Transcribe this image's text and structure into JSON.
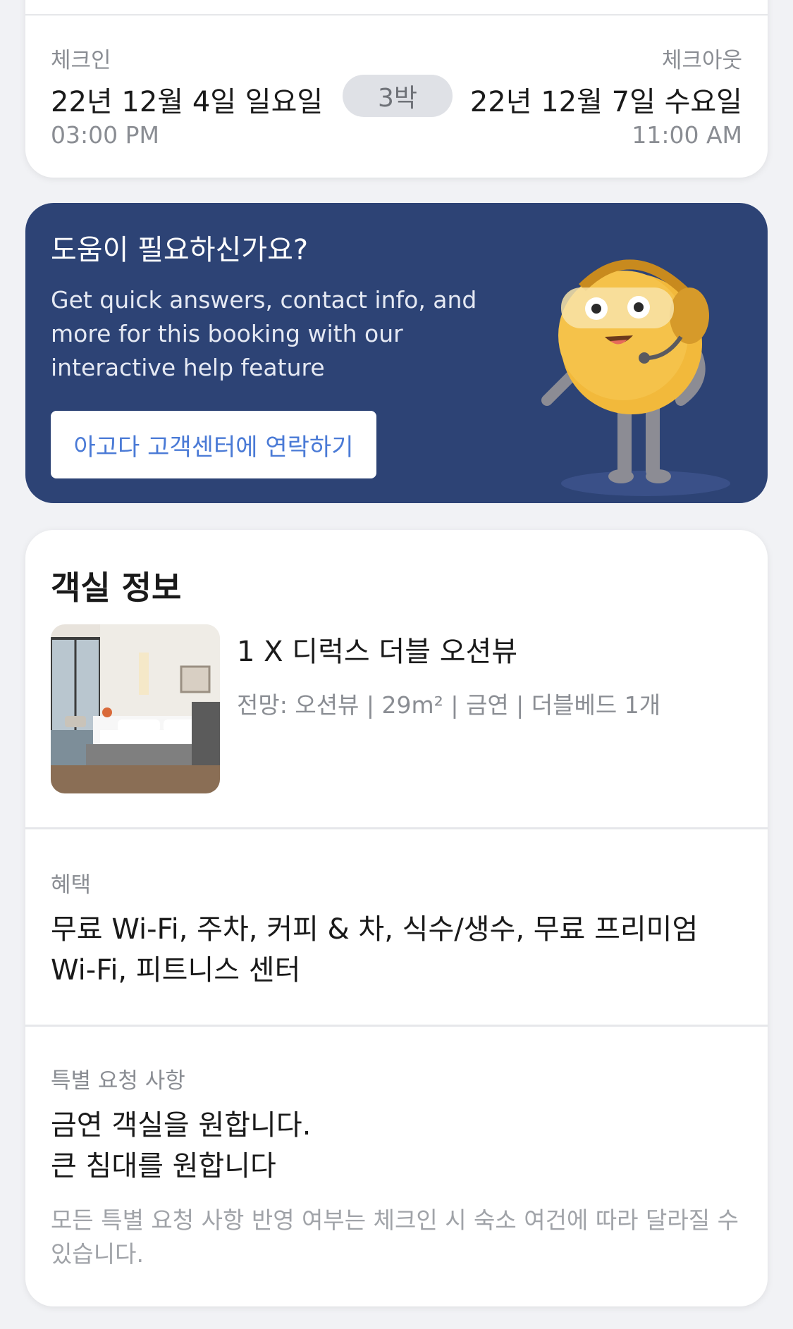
{
  "stay": {
    "checkin_label": "체크인",
    "checkin_date": "22년 12월 4일 일요일",
    "checkin_time": "03:00 PM",
    "nights": "3박",
    "checkout_label": "체크아웃",
    "checkout_date": "22년 12월 7일 수요일",
    "checkout_time": "11:00 AM"
  },
  "help": {
    "title": "도움이 필요하신가요?",
    "description": "Get quick answers, contact info, and more for this booking with our interactive help feature",
    "button_label": "아고다 고객센터에 연락하기",
    "background_color": "#2d4375",
    "mascot_icon": "headset-mascot-icon"
  },
  "room": {
    "section_title": "객실 정보",
    "name": "1 X 디럭스 더블 오션뷰",
    "specs": "전망: 오션뷰 | 29m² | 금연 | 더블베드 1개",
    "benefits_label": "혜택",
    "benefits": "무료 Wi-Fi, 주차, 커피 & 차, 식수/생수, 무료 프리미엄 Wi-Fi, 피트니스 센터",
    "requests_label": "특별 요청 사항",
    "request_1": "금연 객실을 원합니다.",
    "request_2": "큰 침대를 원합니다",
    "request_note": "모든 특별 요청 사항 반영 여부는 체크인 시 숙소 여건에 따라 달라질 수 있습니다."
  },
  "colors": {
    "link_blue": "#4a7ad6",
    "muted_text": "#8a8d93"
  }
}
